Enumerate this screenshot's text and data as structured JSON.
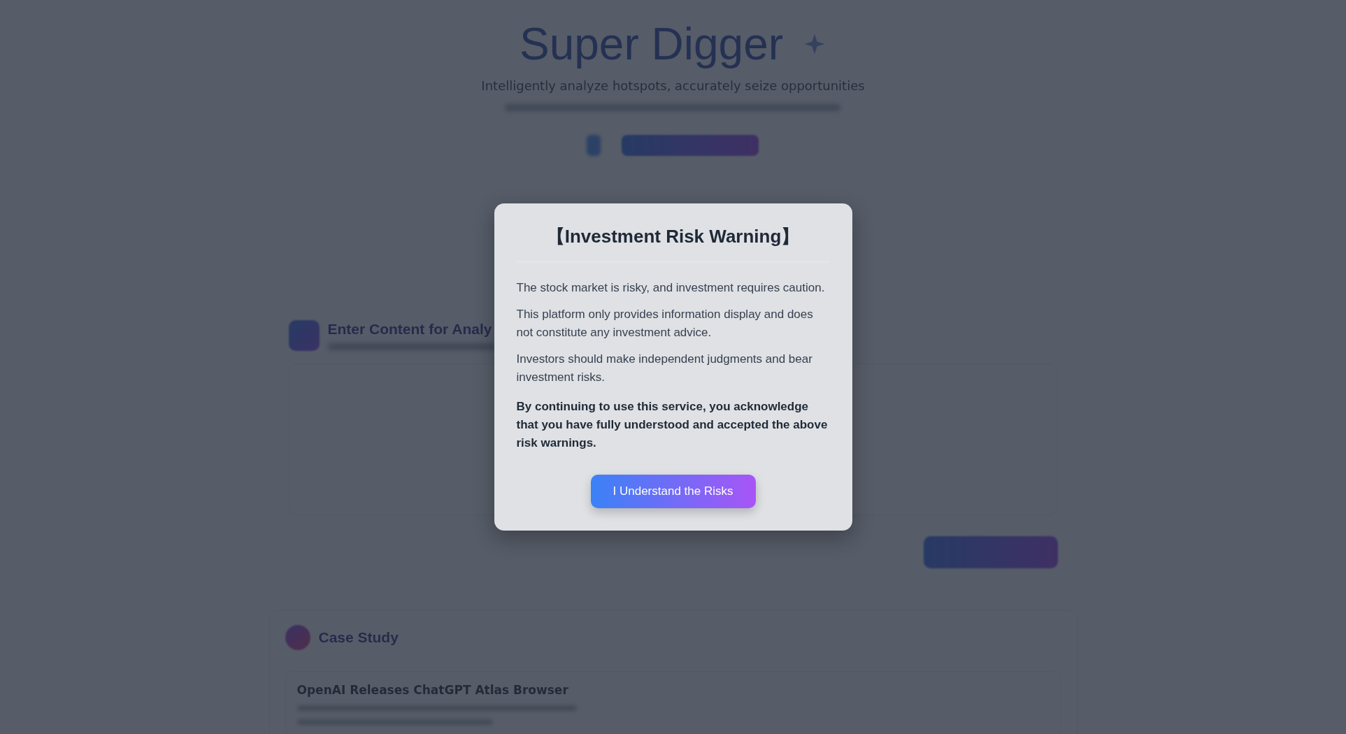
{
  "header": {
    "title": "Super Digger",
    "subtitle": "Intelligently analyze hotspots, accurately seize opportunities"
  },
  "input_section": {
    "title": "Enter Content for Analy"
  },
  "case_study": {
    "title": "Case Study",
    "items": [
      {
        "title": "OpenAI Releases ChatGPT Atlas Browser"
      }
    ]
  },
  "modal": {
    "title": "【Investment Risk Warning】",
    "paragraphs": [
      {
        "kind": "normal",
        "text": "The stock market is risky, and investment requires caution."
      },
      {
        "kind": "normal",
        "text": "This platform only provides information display and does not constitute any investment advice."
      },
      {
        "kind": "normal",
        "text": "Investors should make independent judgments and bear investment risks."
      },
      {
        "kind": "emphasis",
        "text": "By continuing to use this service, you acknowledge that you have fully understood and accepted the above risk warnings."
      }
    ],
    "button": "I Understand the Risks"
  }
}
